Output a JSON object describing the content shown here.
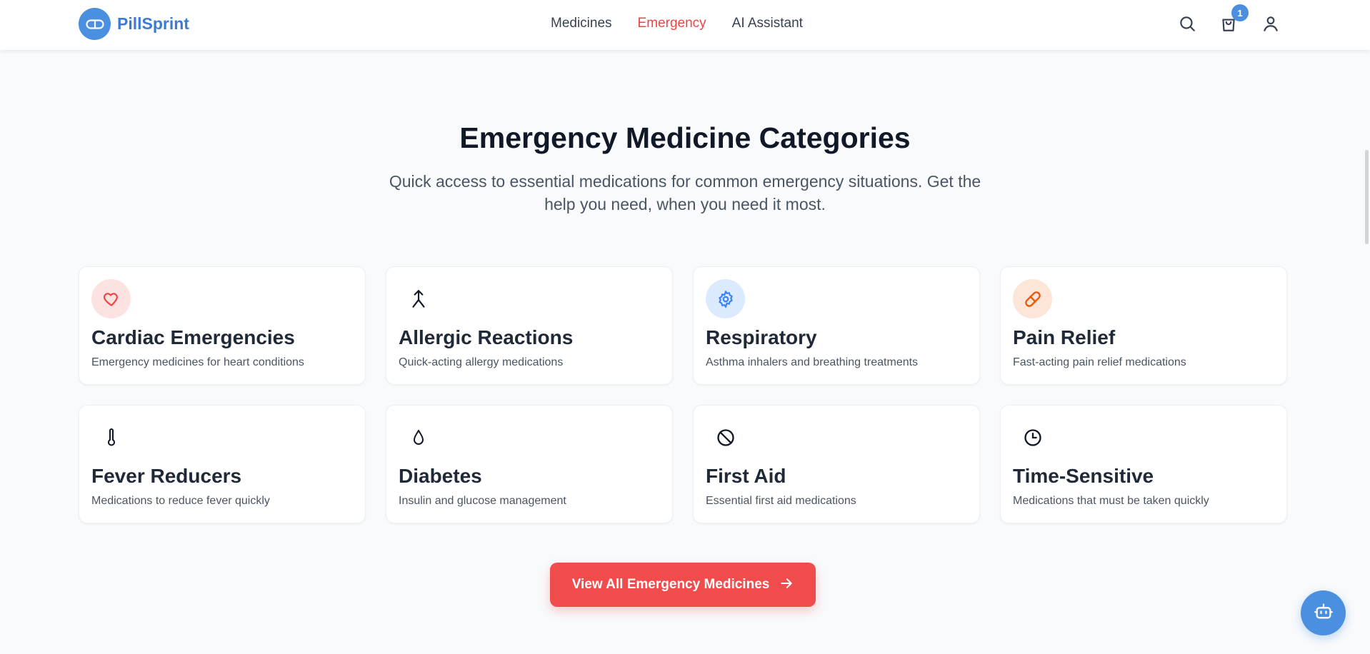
{
  "brand": {
    "name": "PillSprint",
    "accent": "#3b7bd6"
  },
  "nav": {
    "items": [
      {
        "label": "Medicines",
        "active": false
      },
      {
        "label": "Emergency",
        "active": true
      },
      {
        "label": "AI Assistant",
        "active": false
      }
    ]
  },
  "header": {
    "icons": [
      "search-icon",
      "cart-icon",
      "user-icon"
    ],
    "cart_count": "1"
  },
  "section": {
    "title": "Emergency Medicine Categories",
    "subtitle": "Quick access to essential medications for common emergency situations. Get the help you need, when you need it most."
  },
  "categories": [
    {
      "title": "Cardiac Emergencies",
      "description": "Emergency medicines for heart conditions",
      "icon": "heart-icon",
      "icon_color": "#ef4444",
      "icon_bg": "#fde2e2"
    },
    {
      "title": "Allergic Reactions",
      "description": "Quick-acting allergy medications",
      "icon": "merge-arrow-icon",
      "icon_color": "#111827",
      "icon_bg": "#ffffff"
    },
    {
      "title": "Respiratory",
      "description": "Asthma inhalers and breathing treatments",
      "icon": "gear-icon",
      "icon_color": "#3b82f6",
      "icon_bg": "#dbeafe"
    },
    {
      "title": "Pain Relief",
      "description": "Fast-acting pain relief medications",
      "icon": "pill-icon",
      "icon_color": "#ea580c",
      "icon_bg": "#fde5d8"
    },
    {
      "title": "Fever Reducers",
      "description": "Medications to reduce fever quickly",
      "icon": "thermometer-icon",
      "icon_color": "#111827",
      "icon_bg": "#ffffff"
    },
    {
      "title": "Diabetes",
      "description": "Insulin and glucose management",
      "icon": "droplet-icon",
      "icon_color": "#111827",
      "icon_bg": "#ffffff"
    },
    {
      "title": "First Aid",
      "description": "Essential first aid medications",
      "icon": "ban-icon",
      "icon_color": "#111827",
      "icon_bg": "#ffffff"
    },
    {
      "title": "Time-Sensitive",
      "description": "Medications that must be taken quickly",
      "icon": "clock-icon",
      "icon_color": "#111827",
      "icon_bg": "#ffffff"
    }
  ],
  "cta": {
    "label": "View All Emergency Medicines",
    "color": "#f04c4c"
  },
  "assistant_fab": {
    "icon": "bot-icon"
  }
}
